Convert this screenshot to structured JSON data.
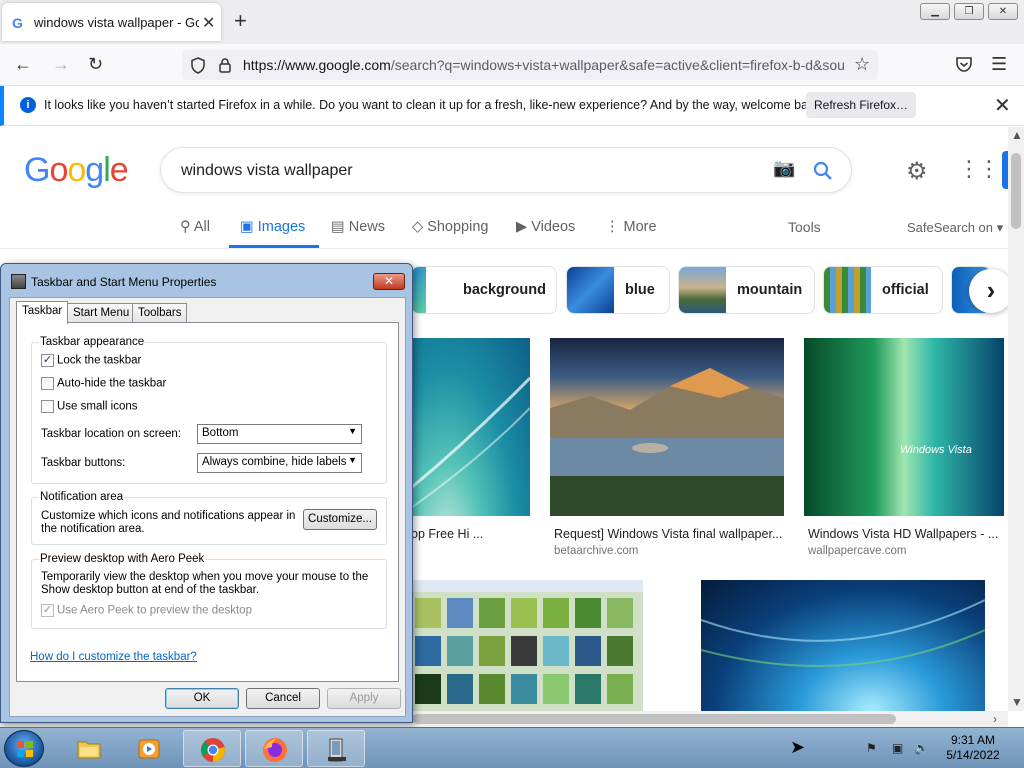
{
  "browser": {
    "tab_title": "windows vista wallpaper - Google Search",
    "favicon": "G",
    "url_domain": "https://www.google.com",
    "url_path": "/search?q=windows+vista+wallpaper&safe=active&client=firefox-b-d&sou",
    "notification": "It looks like you haven’t started Firefox in a while. Do you want to clean it up for a fresh, like-new experience? And by the way, welcome back!",
    "notification_button": "Refresh Firefox…"
  },
  "google": {
    "query": "windows vista wallpaper",
    "tabs": [
      {
        "label": "All",
        "icon": "search-icon"
      },
      {
        "label": "Images",
        "icon": "image-icon"
      },
      {
        "label": "News",
        "icon": "news-icon"
      },
      {
        "label": "Shopping",
        "icon": "tag-icon"
      },
      {
        "label": "Videos",
        "icon": "play-icon"
      },
      {
        "label": "More",
        "icon": "more-vert-icon"
      }
    ],
    "tools": "Tools",
    "safesearch": "SafeSearch on ▾",
    "chips": [
      "background",
      "blue",
      "mountain",
      "official"
    ],
    "results": [
      {
        "caption": "op Free Hi ...",
        "source": ""
      },
      {
        "caption": "Request] Windows Vista final wallpaper...",
        "source": "betaarchive.com"
      },
      {
        "caption": "Windows Vista HD Wallpapers - ...",
        "source": "wallpapercave.com"
      }
    ],
    "vista_logo_text": "Windows Vista"
  },
  "dialog": {
    "title": "Taskbar and Start Menu Properties",
    "tabs": [
      "Taskbar",
      "Start Menu",
      "Toolbars"
    ],
    "appearance_label": "Taskbar appearance",
    "lock_label": "Lock the taskbar",
    "lock_checked": true,
    "autohide_label": "Auto-hide the taskbar",
    "small_icons_label": "Use small icons",
    "location_label": "Taskbar location on screen:",
    "location_value": "Bottom",
    "buttons_label": "Taskbar buttons:",
    "buttons_value": "Always combine, hide labels",
    "notification_label": "Notification area",
    "notification_text": "Customize which icons and notifications appear in the notification area.",
    "customize_button": "Customize...",
    "peek_label": "Preview desktop with Aero Peek",
    "peek_text": "Temporarily view the desktop when you move your mouse to the Show desktop button at end of the taskbar.",
    "peek_checkbox_label": "Use Aero Peek to preview the desktop",
    "help_link": "How do I customize the taskbar?",
    "ok": "OK",
    "cancel": "Cancel",
    "apply": "Apply"
  },
  "taskbar": {
    "time": "9:31 AM",
    "date": "5/14/2022"
  }
}
